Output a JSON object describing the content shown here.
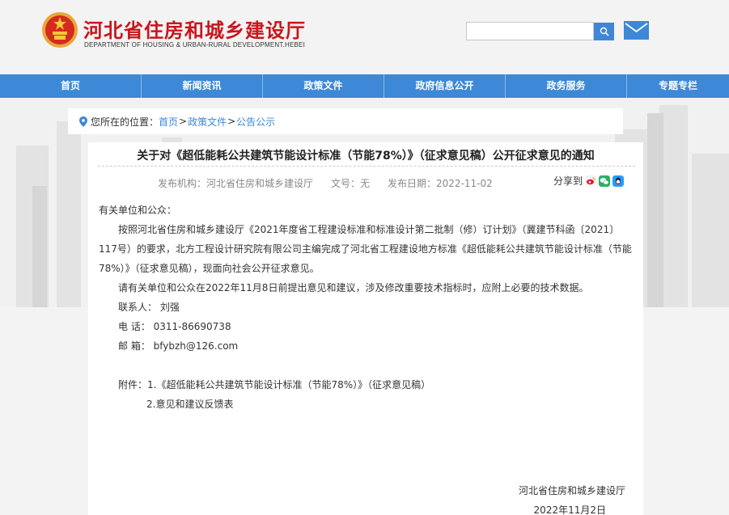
{
  "header": {
    "title": "河北省住房和城乡建设厅",
    "subtitle": "DEPARTMENT OF HOUSING & URBAN-RURAL DEVELOPMENT.HEBEI",
    "search_placeholder": "",
    "icons": [
      "emblem-icon",
      "search-icon",
      "mail-icon"
    ]
  },
  "nav": {
    "items": [
      "首页",
      "新闻资讯",
      "政策文件",
      "政府信息公开",
      "政务服务",
      "专题专栏"
    ]
  },
  "breadcrumb": {
    "prefix": "您所在的位置：",
    "items": [
      "首页",
      "政策文件",
      "公告公示"
    ],
    "separator": ">"
  },
  "article": {
    "title": "关于对《超低能耗公共建筑节能设计标准（节能78%）》（征求意见稿）公开征求意见的通知",
    "publisher": "发布机构：河北省住房和城乡建设厅",
    "doc_no": "文号：无",
    "date": "发布日期：2022-11-02",
    "share_label": "分享到",
    "salutation": "有关单位和公众：",
    "para1": "按照河北省住房和城乡建设厅《2021年度省工程建设标准和标准设计第二批制（修）订计划》（冀建节科函〔2021〕117号）的要求，北方工程设计研究院有限公司主编完成了河北省工程建设地方标准《超低能耗公共建筑节能设计标准（节能78%）》（征求意见稿），现面向社会公开征求意见。",
    "para2": "请有关单位和公众在2022年11月8日前提出意见和建议，涉及修改重要技术指标时，应附上必要的技术数据。",
    "contact": "联系人： 刘强",
    "phone": "电  话： 0311-86690738",
    "email": "邮  箱： bfybzh@126.com",
    "attachment1": "附件：1.《超低能耗公共建筑节能设计标准（节能78%）》（征求意见稿）",
    "attachment2": "2.意见和建议反馈表",
    "signature_org": "河北省住房和城乡建设厅",
    "signature_date": "2022年11月2日"
  },
  "colors": {
    "brand_red": "#c8161d",
    "nav_blue": "#3d88d7",
    "link_blue": "#3d88d7",
    "weibo": "#e6162d",
    "wechat": "#2aae67",
    "qq": "#1e9fff"
  }
}
